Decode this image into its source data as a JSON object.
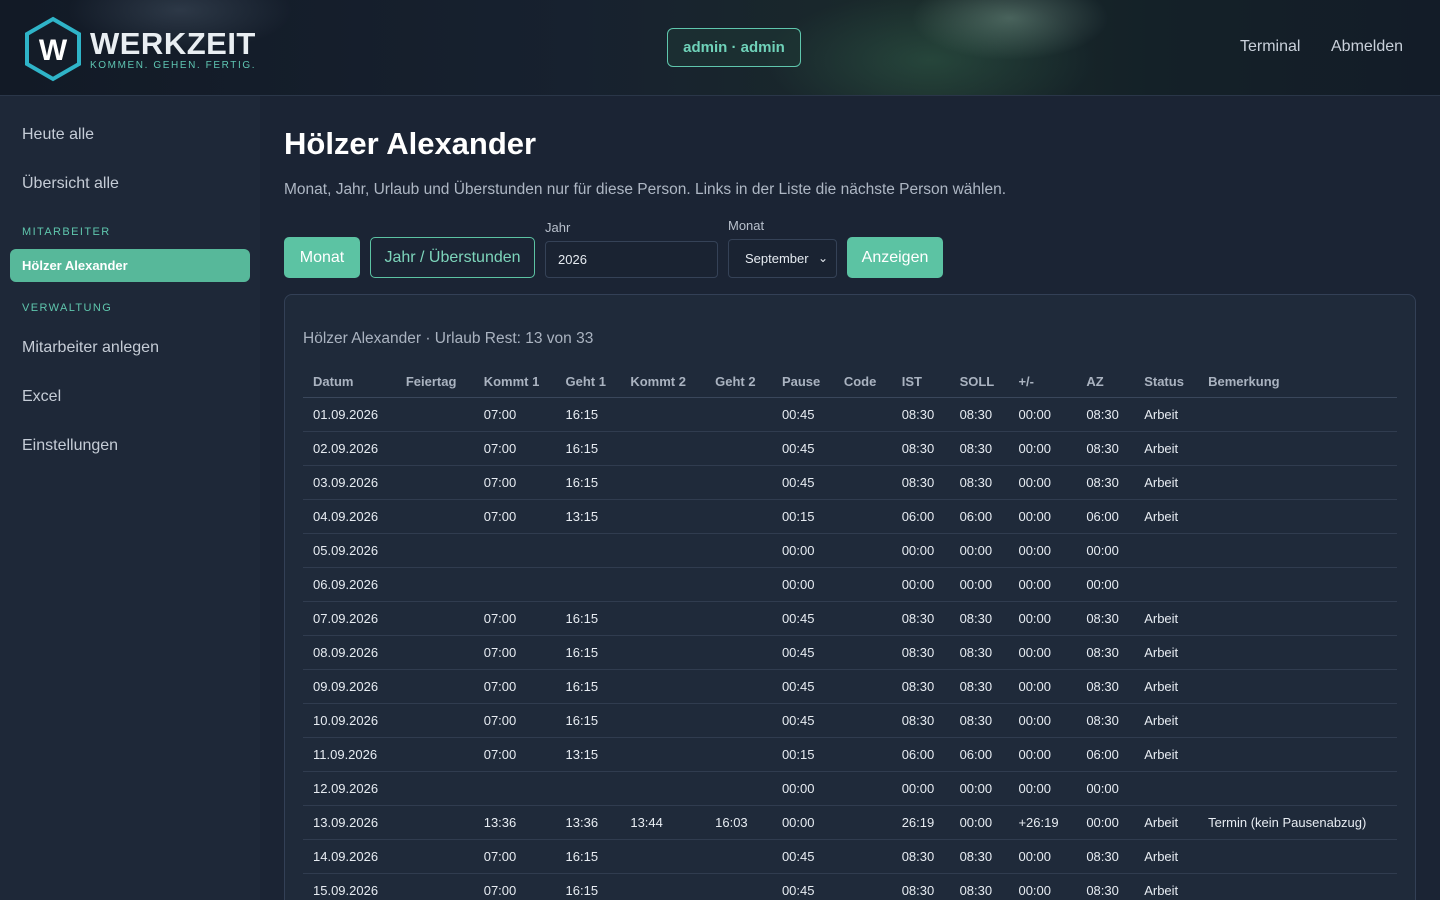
{
  "header": {
    "logo_letter": "W",
    "logo_title": "WERKZEIT",
    "logo_tagline": "KOMMEN. GEHEN. FERTIG.",
    "user_badge": "admin · admin",
    "nav": {
      "terminal": "Terminal",
      "logout": "Abmelden"
    }
  },
  "sidebar": {
    "today_all": "Heute alle",
    "overview_all": "Übersicht alle",
    "section_employees": "MITARBEITER",
    "active_employee": "Hölzer Alexander",
    "section_admin": "VERWALTUNG",
    "create_employee": "Mitarbeiter anlegen",
    "excel": "Excel",
    "settings": "Einstellungen"
  },
  "main": {
    "title": "Hölzer Alexander",
    "description": "Monat, Jahr, Urlaub und Überstunden nur für diese Person. Links in der Liste die nächste Person wählen.",
    "buttons": {
      "month": "Monat",
      "year_overtime": "Jahr / Überstunden",
      "show": "Anzeigen"
    },
    "year_label": "Jahr",
    "year_value": "2026",
    "month_label": "Monat",
    "month_value": "September"
  },
  "card": {
    "title": "Hölzer Alexander · Urlaub Rest: 13 von 33",
    "columns": [
      "Datum",
      "Feiertag",
      "Kommt 1",
      "Geht 1",
      "Kommt 2",
      "Geht 2",
      "Pause",
      "Code",
      "IST",
      "SOLL",
      "+/-",
      "AZ",
      "Status",
      "Bemerkung"
    ],
    "rows": [
      [
        "01.09.2026",
        "",
        "07:00",
        "16:15",
        "",
        "",
        "00:45",
        "",
        "08:30",
        "08:30",
        "00:00",
        "08:30",
        "Arbeit",
        ""
      ],
      [
        "02.09.2026",
        "",
        "07:00",
        "16:15",
        "",
        "",
        "00:45",
        "",
        "08:30",
        "08:30",
        "00:00",
        "08:30",
        "Arbeit",
        ""
      ],
      [
        "03.09.2026",
        "",
        "07:00",
        "16:15",
        "",
        "",
        "00:45",
        "",
        "08:30",
        "08:30",
        "00:00",
        "08:30",
        "Arbeit",
        ""
      ],
      [
        "04.09.2026",
        "",
        "07:00",
        "13:15",
        "",
        "",
        "00:15",
        "",
        "06:00",
        "06:00",
        "00:00",
        "06:00",
        "Arbeit",
        ""
      ],
      [
        "05.09.2026",
        "",
        "",
        "",
        "",
        "",
        "00:00",
        "",
        "00:00",
        "00:00",
        "00:00",
        "00:00",
        "",
        ""
      ],
      [
        "06.09.2026",
        "",
        "",
        "",
        "",
        "",
        "00:00",
        "",
        "00:00",
        "00:00",
        "00:00",
        "00:00",
        "",
        ""
      ],
      [
        "07.09.2026",
        "",
        "07:00",
        "16:15",
        "",
        "",
        "00:45",
        "",
        "08:30",
        "08:30",
        "00:00",
        "08:30",
        "Arbeit",
        ""
      ],
      [
        "08.09.2026",
        "",
        "07:00",
        "16:15",
        "",
        "",
        "00:45",
        "",
        "08:30",
        "08:30",
        "00:00",
        "08:30",
        "Arbeit",
        ""
      ],
      [
        "09.09.2026",
        "",
        "07:00",
        "16:15",
        "",
        "",
        "00:45",
        "",
        "08:30",
        "08:30",
        "00:00",
        "08:30",
        "Arbeit",
        ""
      ],
      [
        "10.09.2026",
        "",
        "07:00",
        "16:15",
        "",
        "",
        "00:45",
        "",
        "08:30",
        "08:30",
        "00:00",
        "08:30",
        "Arbeit",
        ""
      ],
      [
        "11.09.2026",
        "",
        "07:00",
        "13:15",
        "",
        "",
        "00:15",
        "",
        "06:00",
        "06:00",
        "00:00",
        "06:00",
        "Arbeit",
        ""
      ],
      [
        "12.09.2026",
        "",
        "",
        "",
        "",
        "",
        "00:00",
        "",
        "00:00",
        "00:00",
        "00:00",
        "00:00",
        "",
        ""
      ],
      [
        "13.09.2026",
        "",
        "13:36",
        "13:36",
        "13:44",
        "16:03",
        "00:00",
        "",
        "26:19",
        "00:00",
        "+26:19",
        "00:00",
        "Arbeit",
        "Termin (kein Pausenabzug)"
      ],
      [
        "14.09.2026",
        "",
        "07:00",
        "16:15",
        "",
        "",
        "00:45",
        "",
        "08:30",
        "08:30",
        "00:00",
        "08:30",
        "Arbeit",
        ""
      ],
      [
        "15.09.2026",
        "",
        "07:00",
        "16:15",
        "",
        "",
        "00:45",
        "",
        "08:30",
        "08:30",
        "00:00",
        "08:30",
        "Arbeit",
        ""
      ]
    ]
  },
  "colors": {
    "accent": "#5cc3a3",
    "background": "#1b2434",
    "sidebar": "#1e2838"
  }
}
